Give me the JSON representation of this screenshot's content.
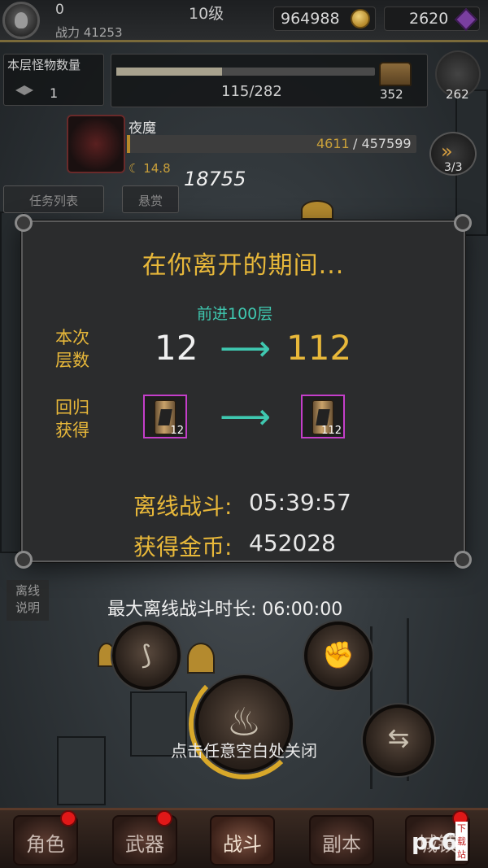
{
  "topbar": {
    "player_num": "0",
    "level": "10级",
    "power": "战力 41253",
    "gold": "964988",
    "gems": "2620"
  },
  "hud": {
    "monster_count_label": "本层怪物数量",
    "monster_count": "1",
    "progress_text": "115/282",
    "progress_fraction": 0.41,
    "chest_count": "352",
    "tower_count": "262",
    "boss_name": "夜魔",
    "boss_hp_current": "4611",
    "boss_hp_total": "/ 457599",
    "boss_hp_fraction": 0.01,
    "boss_stat": "14.8",
    "speed_label": "3/3",
    "damage_float": "18755",
    "task_list_button": "任务列表",
    "reward_button": "悬赏"
  },
  "modal": {
    "title": "在你离开的期间...",
    "advance_label": "前进100层",
    "floors_label": "本次\n层数",
    "floors_from": "12",
    "floors_to": "112",
    "return_label": "回归\n获得",
    "item_from_count": "12",
    "item_to_count": "112",
    "offline_battle_label": "离线战斗:",
    "offline_battle_value": "05:39:57",
    "gold_label": "获得金币:",
    "gold_value": "452028",
    "arrow_glyph": "⟶"
  },
  "max_offline": "最大离线战斗时长:  06:00:00",
  "offline_help_button": "离线\n说明",
  "close_hint": "点击任意空白处关闭",
  "nav": {
    "items": [
      {
        "label": "角色",
        "badge": true
      },
      {
        "label": "武器",
        "badge": true
      },
      {
        "label": "战斗",
        "badge": false,
        "active": true
      },
      {
        "label": "副本",
        "badge": false
      },
      {
        "label": "城镇",
        "badge": true
      }
    ]
  },
  "watermark": "pc6",
  "watermark_sub": "下载站",
  "colors": {
    "accent_gold": "#e8b83a",
    "arrow_teal": "#3fc8b0",
    "item_border": "#c43ec9",
    "badge_red": "#e01818"
  }
}
